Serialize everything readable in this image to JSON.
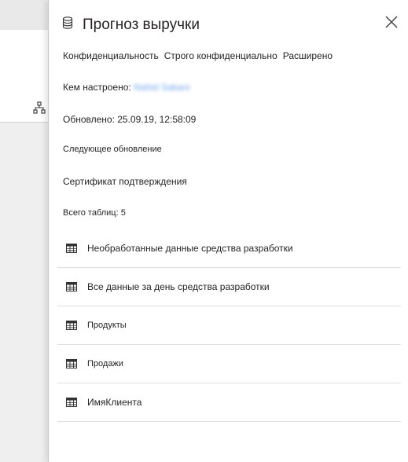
{
  "panel": {
    "title": "Прогноз выручки",
    "icon": "database-icon",
    "close_icon": "close-icon"
  },
  "sensitivity": {
    "label": "Конфиденциальность",
    "value": "Строго конфиденциально",
    "level": "Расширено"
  },
  "owner": {
    "label": "Кем настроено:",
    "name": "Nahid Sakani"
  },
  "updated": "Обновлено: 25.09.19, 12:58:09",
  "next_refresh": "Следующее обновление",
  "certificate": "Сертификат подтверждения",
  "tables_count": "Всего таблиц: 5",
  "tables": [
    {
      "label": "Необработанные данные средства разработки"
    },
    {
      "label": "Все данные за день средства разработки"
    },
    {
      "label": "Продукты"
    },
    {
      "label": "Продажи"
    },
    {
      "label": "ИмяКлиента"
    }
  ],
  "colors": {
    "panel_bg": "#ffffff",
    "background": "#ececec",
    "text": "#252423",
    "link": "#73a6e8",
    "divider": "#e1dfdd"
  }
}
